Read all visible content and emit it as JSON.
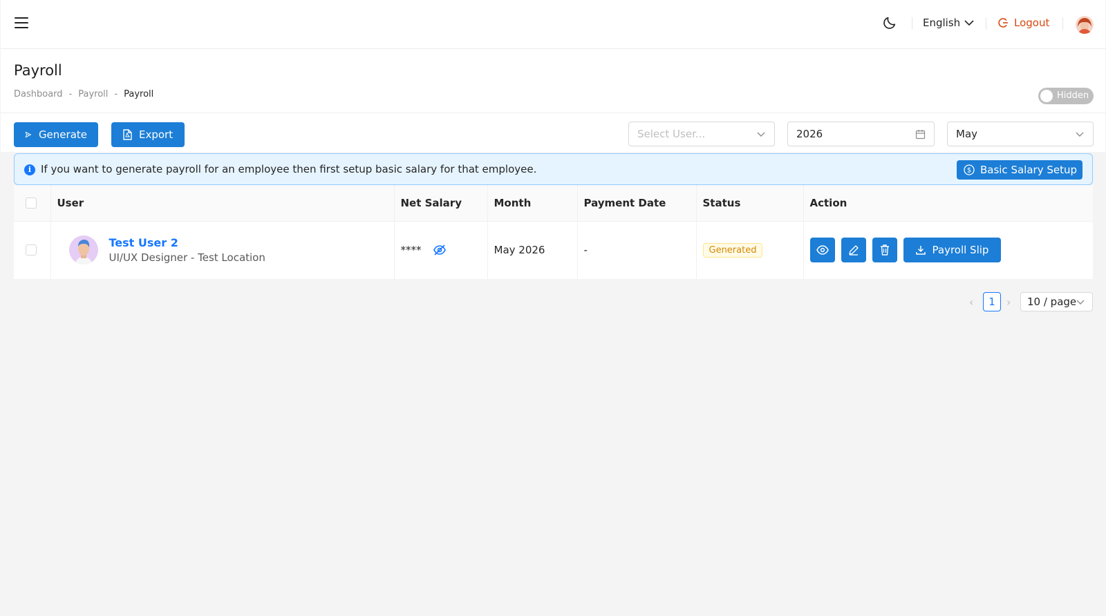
{
  "header": {
    "language": "English",
    "logout_label": "Logout"
  },
  "page": {
    "title": "Payroll",
    "breadcrumb": [
      "Dashboard",
      "Payroll",
      "Payroll"
    ],
    "toggle_label": "Hidden"
  },
  "toolbar": {
    "generate_label": "Generate",
    "export_label": "Export",
    "user_select_placeholder": "Select User...",
    "year_value": "2026",
    "month_value": "May"
  },
  "alert": {
    "message": "If you want to generate payroll for an employee then first setup basic salary for that employee.",
    "button_label": "Basic Salary Setup"
  },
  "table": {
    "columns": [
      "User",
      "Net Salary",
      "Month",
      "Payment Date",
      "Status",
      "Action"
    ],
    "rows": [
      {
        "name": "Test User 2",
        "subtitle": "UI/UX Designer - Test Location",
        "net_salary": "****",
        "month": "May 2026",
        "payment_date": "-",
        "status": "Generated",
        "slip_label": "Payroll Slip"
      }
    ]
  },
  "pagination": {
    "current_page": "1",
    "page_size": "10 / page"
  },
  "colors": {
    "primary": "#1c7ed6",
    "logout": "#d9480f",
    "status_generated": "#d48806"
  }
}
